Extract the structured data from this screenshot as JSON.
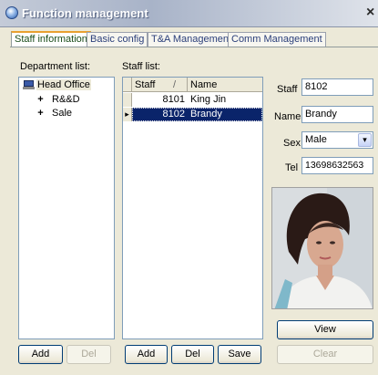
{
  "window": {
    "title": "Function management",
    "close_glyph": "×"
  },
  "tabs": [
    {
      "label": "Staff information",
      "active": true
    },
    {
      "label": "Basic config",
      "active": false
    },
    {
      "label": "T&A Management",
      "active": false
    },
    {
      "label": "Comm Management",
      "active": false
    }
  ],
  "department": {
    "label": "Department list:",
    "root": "Head Office",
    "children": [
      "R&&D",
      "Sale"
    ],
    "add_label": "Add",
    "del_label": "Del"
  },
  "staff_list": {
    "label": "Staff list:",
    "columns": [
      "Staff",
      "Name"
    ],
    "sort_indicator": "/",
    "rows": [
      {
        "staff": "8101",
        "name": "King Jin",
        "selected": false
      },
      {
        "staff": "8102",
        "name": "Brandy",
        "selected": true
      }
    ],
    "add_label": "Add",
    "del_label": "Del",
    "save_label": "Save"
  },
  "detail": {
    "staff_label": "Staff",
    "staff_value": "8102",
    "name_label": "Name",
    "name_value": "Brandy",
    "sex_label": "Sex",
    "sex_value": "Male",
    "tel_label": "Tel",
    "tel_value": "13698632563",
    "view_label": "View",
    "clear_label": "Clear"
  },
  "colors": {
    "selection": "#0a246a",
    "accent_tab": "#e8a030"
  }
}
